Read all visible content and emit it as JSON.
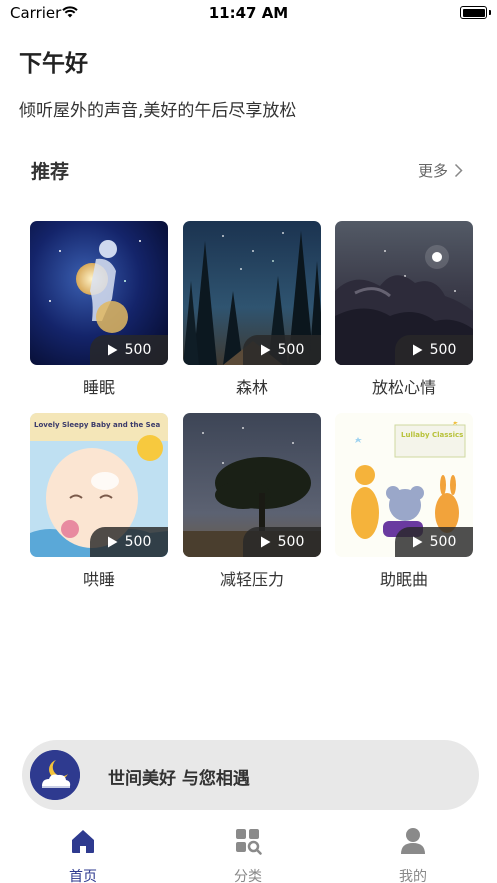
{
  "status_bar": {
    "carrier": "Carrier",
    "time": "11:47 AM"
  },
  "header": {
    "greeting": "下午好",
    "subtitle": "倾听屋外的声音,美好的午后尽享放松"
  },
  "recommend": {
    "title": "推荐",
    "more_label": "更多",
    "items": [
      {
        "label": "睡眠",
        "plays": "500"
      },
      {
        "label": "森林",
        "plays": "500"
      },
      {
        "label": "放松心情",
        "plays": "500"
      },
      {
        "label": "哄睡",
        "plays": "500",
        "art_text": "Lovely Sleepy Baby and the Sea"
      },
      {
        "label": "减轻压力",
        "plays": "500"
      },
      {
        "label": "助眠曲",
        "plays": "500",
        "art_text": "Lullaby Classics"
      }
    ]
  },
  "player": {
    "title": "世间美好 与您相遇"
  },
  "tabbar": {
    "tabs": [
      {
        "label": "首页",
        "icon": "home-icon",
        "active": true
      },
      {
        "label": "分类",
        "icon": "category-icon",
        "active": false
      },
      {
        "label": "我的",
        "icon": "profile-icon",
        "active": false
      }
    ]
  },
  "colors": {
    "accent": "#2e3a8f",
    "inactive": "#888888",
    "player_bg": "#e8e8e8"
  }
}
